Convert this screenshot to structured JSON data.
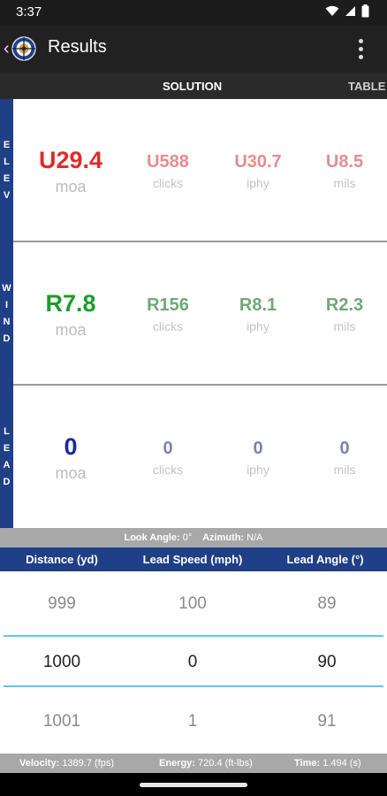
{
  "status_bar": {
    "time": "3:37"
  },
  "app_bar": {
    "title": "Results"
  },
  "tabs": [
    {
      "label": "SOLUTION",
      "active": true
    },
    {
      "label": "TABLE",
      "active": false
    }
  ],
  "sections": {
    "elev": {
      "label": [
        "E",
        "L",
        "E",
        "V"
      ],
      "color_primary": "#e02a2a",
      "color_secondary": "#e88c8c",
      "primary": {
        "value": "U29.4",
        "unit": "moa"
      },
      "clicks": {
        "value": "U588",
        "unit": "clicks"
      },
      "iphy": {
        "value": "U30.7",
        "unit": "iphy"
      },
      "mils": {
        "value": "U8.5",
        "unit": "mils"
      }
    },
    "wind": {
      "label": [
        "W",
        "I",
        "N",
        "D"
      ],
      "color_primary": "#1c9c2a",
      "color_secondary": "#6fa878",
      "primary": {
        "value": "R7.8",
        "unit": "moa"
      },
      "clicks": {
        "value": "R156",
        "unit": "clicks"
      },
      "iphy": {
        "value": "R8.1",
        "unit": "iphy"
      },
      "mils": {
        "value": "R2.3",
        "unit": "mils"
      }
    },
    "lead": {
      "label": [
        "L",
        "E",
        "A",
        "D"
      ],
      "color_primary": "#1c2a9c",
      "color_secondary": "#7a82b8",
      "primary": {
        "value": "0",
        "unit": "moa"
      },
      "clicks": {
        "value": "0",
        "unit": "clicks"
      },
      "iphy": {
        "value": "0",
        "unit": "iphy"
      },
      "mils": {
        "value": "0",
        "unit": "mils"
      }
    }
  },
  "look_bar": {
    "look_angle_label": "Look Angle:",
    "look_angle_value": "0°",
    "azimuth_label": "Azimuth:",
    "azimuth_value": "N/A"
  },
  "table": {
    "headers": [
      "Distance (yd)",
      "Lead Speed (mph)",
      "Lead Angle (°)"
    ],
    "rows": [
      {
        "distance": "999",
        "speed": "100",
        "angle": "89"
      },
      {
        "distance": "1000",
        "speed": "0",
        "angle": "90"
      },
      {
        "distance": "1001",
        "speed": "1",
        "angle": "91"
      }
    ]
  },
  "footer": {
    "velocity_label": "Velocity:",
    "velocity_value": "1389.7 (fps)",
    "energy_label": "Energy:",
    "energy_value": "720.4 (ft-lbs)",
    "time_label": "Time:",
    "time_value": "1.494 (s)"
  }
}
